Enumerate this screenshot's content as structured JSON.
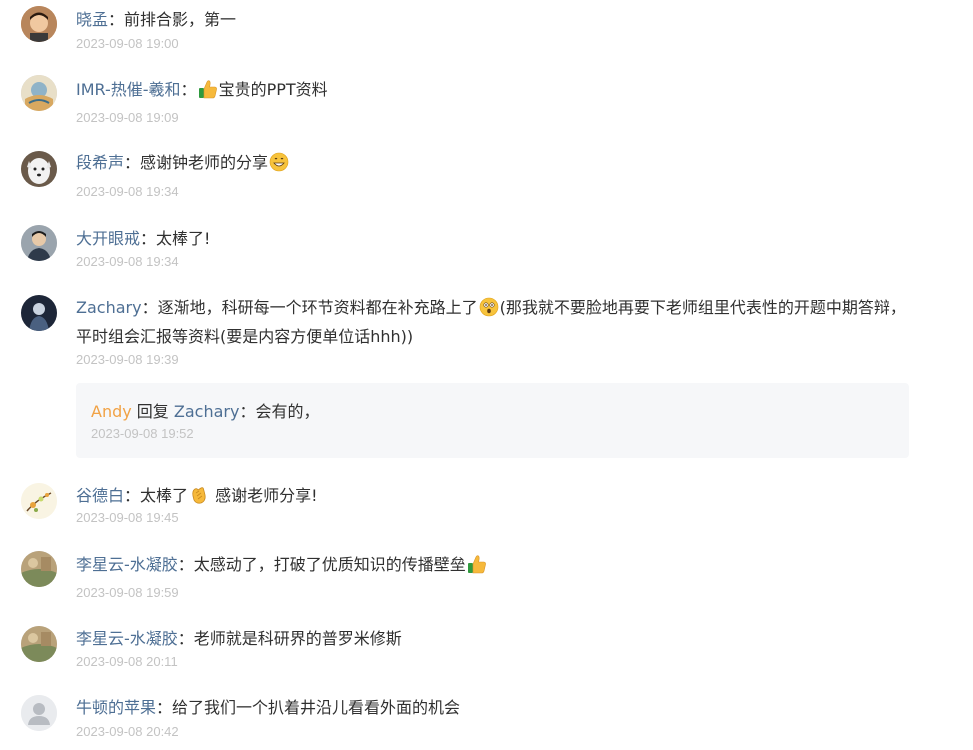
{
  "comments": [
    {
      "name": "晓孟",
      "sep": "：",
      "text": "前排合影，第一",
      "time": "2023-09-08 19:00"
    },
    {
      "name": "IMR-热催-羲和",
      "sep": "：",
      "text": "宝贵的PPT资料",
      "time": "2023-09-08 19:09",
      "emoji": "thumbs-up-icon"
    },
    {
      "name": "段希声",
      "sep": "：",
      "text": "感谢钟老师的分享",
      "time": "2023-09-08 19:34",
      "emoji": "grinning-face-icon"
    },
    {
      "name": "大开眼戒",
      "sep": "：",
      "text": "太棒了!",
      "time": "2023-09-08 19:34"
    },
    {
      "name": "Zachary",
      "sep": "：",
      "text_a": "逐渐地，科研每一个环节资料都在补充路上了",
      "text_b": "(那我就不要脸地再要下老师组里代表性的开题中期答辩，平时组会汇报等资料(要是内容方便单位话hhh))",
      "time": "2023-09-08 19:39",
      "emoji": "astonished-face-icon"
    },
    {
      "name": "谷德白",
      "sep": "：",
      "text_a": "太棒了",
      "text_b": " 感谢老师分享!",
      "time": "2023-09-08 19:45",
      "emoji": "clapping-hands-icon"
    },
    {
      "name": "李星云-水凝胶",
      "sep": "：",
      "text": "太感动了，打破了优质知识的传播壁垒",
      "time": "2023-09-08 19:59",
      "emoji": "thumbs-up-icon"
    },
    {
      "name": "李星云-水凝胶",
      "sep": "：",
      "text": "老师就是科研界的普罗米修斯",
      "time": "2023-09-08 20:11"
    },
    {
      "name": "牛顿的苹果",
      "sep": "：",
      "text": "给了我们一个扒着井沿儿看看外面的机会",
      "time": "2023-09-08 20:42"
    }
  ],
  "reply": {
    "author": "Andy",
    "verb": " 回复 ",
    "target": "Zachary",
    "sep": "：",
    "text": "会有的，",
    "time": "2023-09-08 19:52"
  },
  "colors": {
    "name": "#4e6f94",
    "reply_author": "#f1a245",
    "time": "#c3c3c3",
    "text": "#303030",
    "reply_bg": "#f6f7f9"
  }
}
